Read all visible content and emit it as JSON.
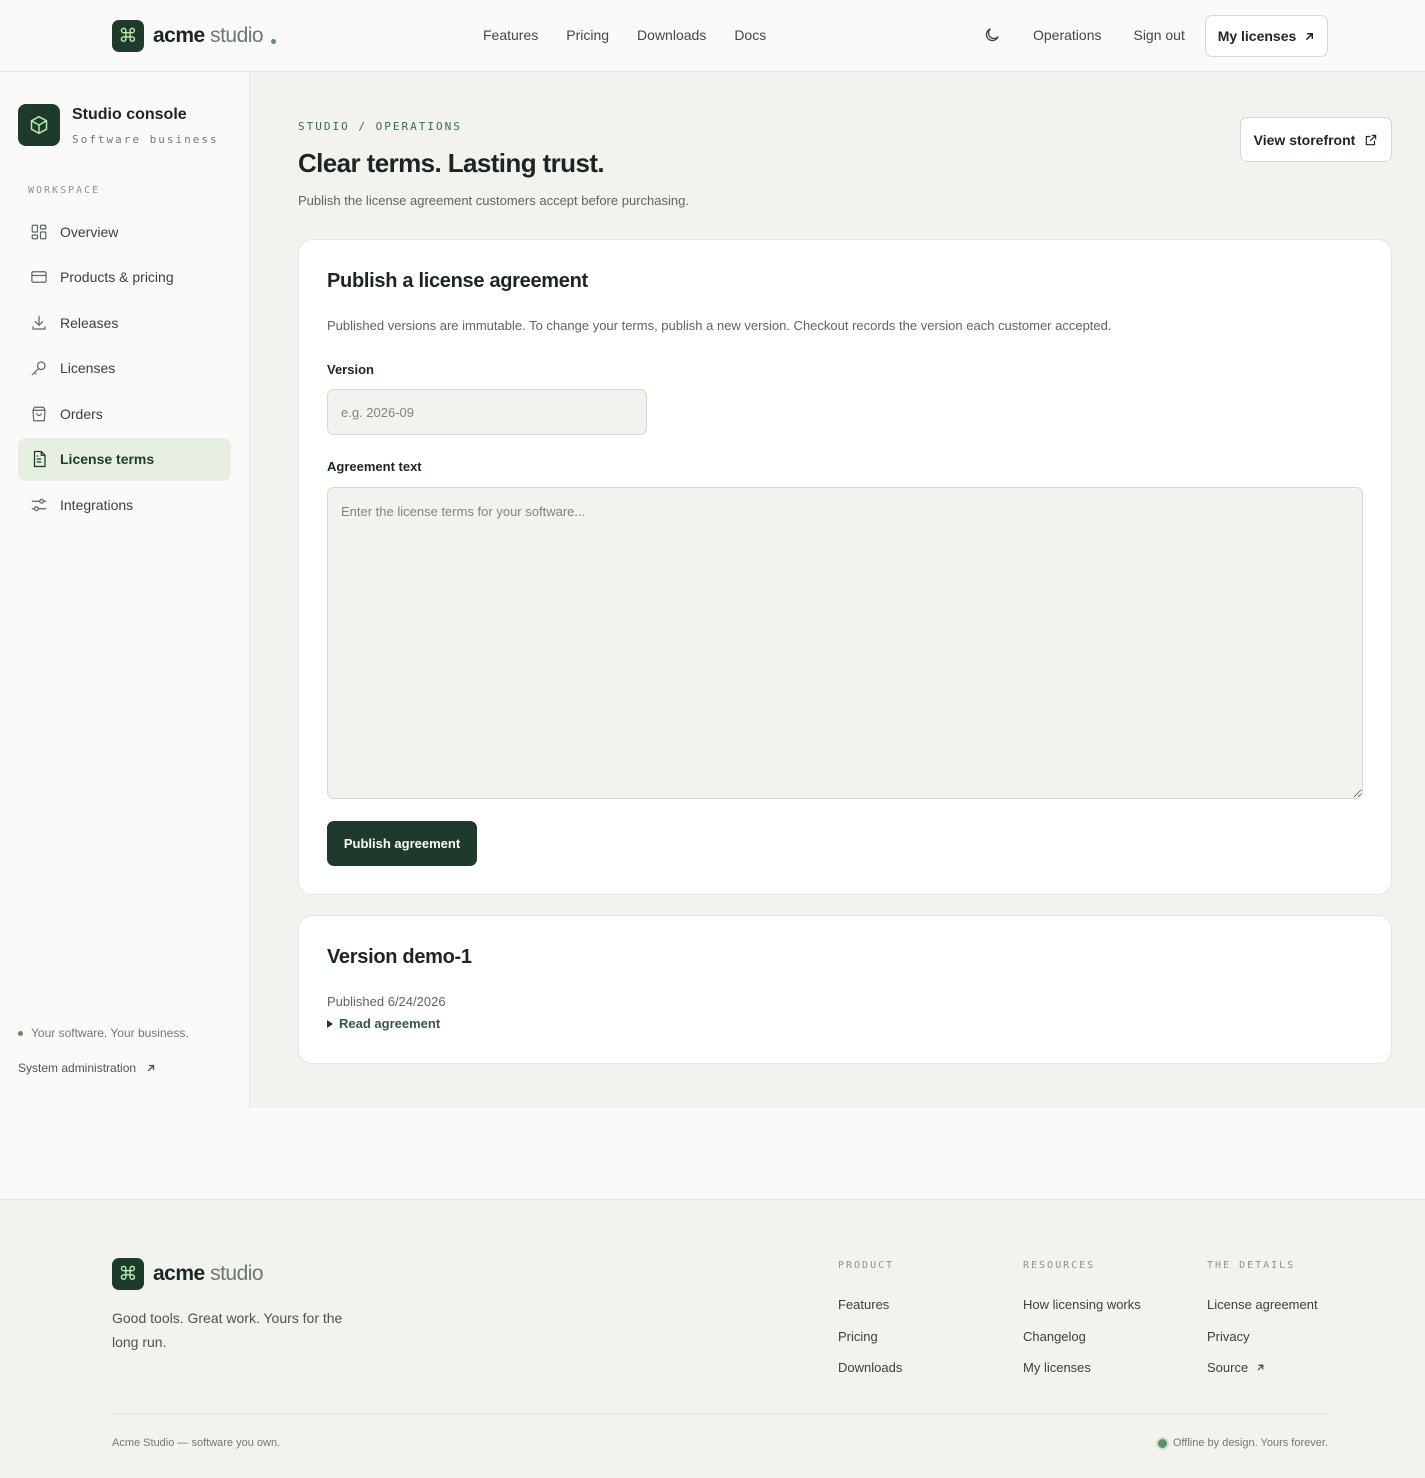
{
  "header": {
    "brand_bold": "acme",
    "brand_light": "studio",
    "nav": [
      "Features",
      "Pricing",
      "Downloads",
      "Docs"
    ],
    "operations_label": "Operations",
    "signout_label": "Sign out",
    "my_licenses_label": "My licenses"
  },
  "sidebar": {
    "title": "Studio console",
    "subtitle": "Software business",
    "section_label": "WORKSPACE",
    "items": [
      {
        "label": "Overview",
        "icon": "grid-icon"
      },
      {
        "label": "Products & pricing",
        "icon": "card-icon"
      },
      {
        "label": "Releases",
        "icon": "download-icon"
      },
      {
        "label": "Licenses",
        "icon": "key-icon"
      },
      {
        "label": "Orders",
        "icon": "bag-icon"
      },
      {
        "label": "License terms",
        "icon": "document-icon",
        "active": true
      },
      {
        "label": "Integrations",
        "icon": "sliders-icon"
      }
    ],
    "tagline": "Your software. Your business.",
    "sysadmin_label": "System administration"
  },
  "page": {
    "breadcrumb": "STUDIO / OPERATIONS",
    "title": "Clear terms. Lasting trust.",
    "subtitle": "Publish the license agreement customers accept before purchasing.",
    "storefront_label": "View storefront"
  },
  "publish_card": {
    "title": "Publish a license agreement",
    "description": "Published versions are immutable. To change your terms, publish a new version. Checkout records the version each customer accepted.",
    "version_label": "Version",
    "version_placeholder": "e.g. 2026-09",
    "version_value": "",
    "agreement_label": "Agreement text",
    "agreement_placeholder": "Enter the license terms for your software...",
    "agreement_value": "",
    "submit_label": "Publish agreement"
  },
  "version_card": {
    "title": "Version demo-1",
    "published": "Published 6/24/2026",
    "read_label": "Read agreement"
  },
  "footer": {
    "brand_bold": "acme",
    "brand_light": "studio",
    "tagline": "Good tools. Great work. Yours for the long run.",
    "columns": [
      {
        "heading": "PRODUCT",
        "links": [
          "Features",
          "Pricing",
          "Downloads"
        ]
      },
      {
        "heading": "RESOURCES",
        "links": [
          "How licensing works",
          "Changelog",
          "My licenses"
        ]
      },
      {
        "heading": "THE DETAILS",
        "links": [
          "License agreement",
          "Privacy",
          "Source"
        ]
      }
    ],
    "copyright": "Acme Studio — software you own.",
    "status": "Offline by design. Yours forever."
  },
  "colors": {
    "accent": "#1e3a2b",
    "accent_soft": "#e6efe2",
    "background": "#f2f3ef"
  }
}
